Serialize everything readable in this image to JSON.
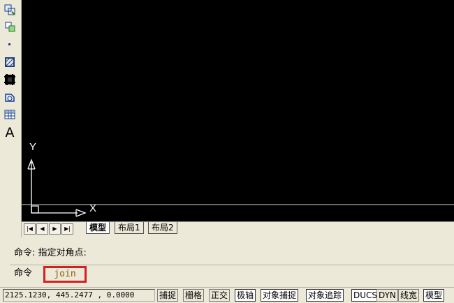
{
  "toolbar": {
    "tools": [
      {
        "icon": "region-icon"
      },
      {
        "icon": "table-style-icon"
      },
      {
        "icon": "point-icon"
      },
      {
        "icon": "hatch-icon"
      },
      {
        "icon": "gradient-icon"
      },
      {
        "icon": "boundary-icon"
      },
      {
        "icon": "table-icon"
      },
      {
        "icon": "multiline-text-icon",
        "glyph": "A"
      }
    ]
  },
  "canvas": {
    "background": "#000000",
    "ucs": {
      "x_label": "X",
      "y_label": "Y",
      "color": "#ffffff"
    }
  },
  "tabs": {
    "nav": [
      "|◀",
      "◀",
      "▶",
      "▶|"
    ],
    "items": [
      {
        "label": "模型",
        "active": true
      },
      {
        "label": "布局1",
        "active": false
      },
      {
        "label": "布局2",
        "active": false
      }
    ]
  },
  "command": {
    "history": "命令: 指定对角点:",
    "prompt": "命令",
    "current_input": "join",
    "highlight_color": "#d62020"
  },
  "status": {
    "coordinates": "2125.1230, 445.2477 , 0.0000",
    "buttons": [
      {
        "label": "捕捉",
        "on": false
      },
      {
        "label": "栅格",
        "on": false
      },
      {
        "label": "正交",
        "on": false
      },
      {
        "label": "极轴",
        "on": true
      },
      {
        "label": "对象捕捉",
        "on": true
      },
      {
        "label": "对象追踪",
        "on": true
      },
      {
        "label": "DUCS",
        "on": true
      },
      {
        "label": "DYN",
        "on": false
      },
      {
        "label": "线宽",
        "on": false
      },
      {
        "label": "模型",
        "on": true
      }
    ]
  }
}
